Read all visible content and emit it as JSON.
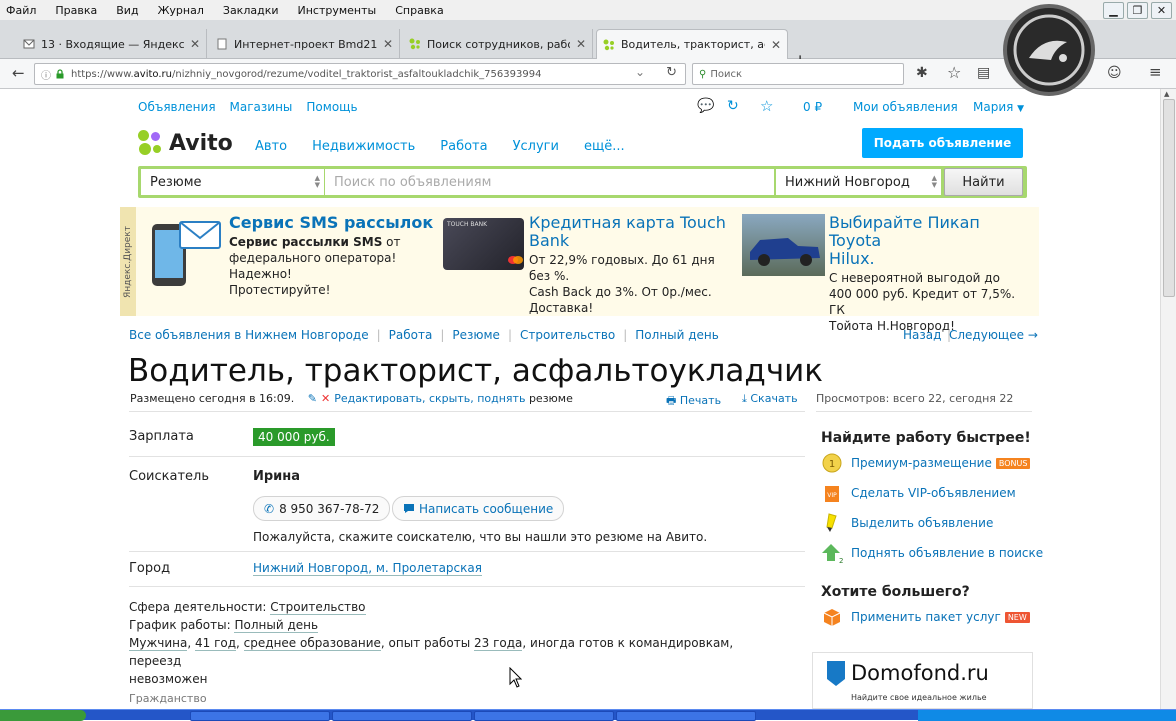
{
  "menu": [
    "Файл",
    "Правка",
    "Вид",
    "Журнал",
    "Закладки",
    "Инструменты",
    "Справка"
  ],
  "tabs": [
    {
      "title": "13 · Входящие — Яндекс.П..."
    },
    {
      "title": "Интернет-проект Bmd21.com"
    },
    {
      "title": "Поиск сотрудников, работн..."
    },
    {
      "title": "Водитель, тракторист, асф..."
    }
  ],
  "address": {
    "prefix": "https://www.",
    "host": "avito.ru",
    "path": "/nizhniy_novgorod/rezume/voditel_traktorist_asfaltoukladchik_756393994"
  },
  "browser_search_placeholder": "Поиск",
  "site_nav": {
    "links": [
      "Объявления",
      "Магазины",
      "Помощь"
    ],
    "wallet": "0 ₽",
    "my_ads": "Мои объявления",
    "user": "Мария"
  },
  "logo_text": "Avito",
  "categories": [
    "Авто",
    "Недвижимость",
    "Работа",
    "Услуги",
    "ещё..."
  ],
  "post_button": "Подать объявление",
  "search": {
    "category": "Резюме",
    "placeholder": "Поиск по объявлениям",
    "city": "Нижний Новгород",
    "button": "Найти"
  },
  "ads_label": "Яндекс.Директ",
  "ads": [
    {
      "title": "Сервис SMS рассылок",
      "lines": [
        "Сервис рассылки SMS от",
        "федерального оператора! Надежно!",
        "Протестируйте!"
      ],
      "bold_prefix": "Сервис рассылки SMS"
    },
    {
      "title_lines": [
        "Кредитная карта Touch",
        "Bank"
      ],
      "lines": [
        "От 22,9% годовых. До 61 дня без %.",
        "Cash Back до 3%. От 0р./мес.",
        "Доставка!"
      ]
    },
    {
      "title_lines": [
        "Выбирайте Пикап Toyota",
        "Hilux."
      ],
      "lines": [
        "С невероятной выгодой до",
        "400 000 руб. Кредит от 7,5%. ГК",
        "Тойота Н.Новгород!"
      ]
    }
  ],
  "card_text": "TOUCH BANK",
  "breadcrumbs": [
    "Все объявления в Нижнем Новгороде",
    "Работа",
    "Резюме",
    "Строительство",
    "Полный день"
  ],
  "pager": {
    "back": "Назад",
    "next": "Следующее →"
  },
  "title": "Водитель, тракторист, асфальтоукладчик",
  "meta": {
    "posted": "Размещено сегодня в 16:09.",
    "edit": "Редактировать, скрыть, поднять",
    "edit_suffix": "резюме",
    "print": "Печать",
    "download": "Скачать",
    "views": "Просмотров: всего 22, сегодня 22"
  },
  "fields": {
    "salary_label": "Зарплата",
    "salary": "40 000 руб.",
    "seeker_label": "Соискатель",
    "seeker": "Ирина",
    "phone": "8 950 367-78-72",
    "message": "Написать сообщение",
    "note": "Пожалуйста, скажите соискателю, что вы нашли это резюме на Авито.",
    "city_label": "Город",
    "city": "Нижний Новгород, м. Пролетарская",
    "sphere_label": "Сфера деятельности:",
    "sphere": "Строительство",
    "schedule_label": "График работы:",
    "schedule": "Полный день",
    "gender": "Мужчина",
    "age": "41 год",
    "education": "среднее образование",
    "exp_prefix": "опыт работы",
    "experience": "23 года",
    "trips": "иногда готов к командировкам, переезд",
    "relocation": "невозможен",
    "citizenship": "Гражданство"
  },
  "sidebar": {
    "heading": "Найдите работу быстрее!",
    "items": [
      {
        "label": "Премиум-размещение",
        "badge": "BONUS"
      },
      {
        "label": "Сделать VIP-объявлением"
      },
      {
        "label": "Выделить объявление"
      },
      {
        "label": "Поднять объявление в поиске"
      }
    ],
    "heading2": "Хотите большего?",
    "package": {
      "label": "Применить пакет услуг",
      "badge": "NEW"
    },
    "domofond": {
      "name": "Domofond.ru",
      "tagline": "Найдите свое идеальное жилье"
    }
  },
  "colors": {
    "link": "#0a73b8",
    "accent": "#00aaff",
    "salary": "#2a9a2a",
    "search_frame": "#a7d86e"
  }
}
